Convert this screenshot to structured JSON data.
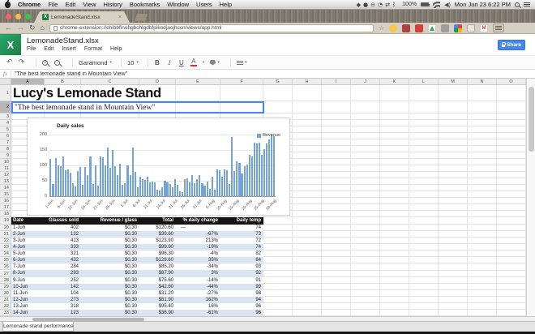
{
  "menubar": {
    "app_menus": [
      "Chrome",
      "File",
      "Edit",
      "View",
      "History",
      "Bookmarks",
      "Window",
      "Users",
      "Help"
    ],
    "status_glyphs": [
      "◆",
      "●",
      "⊖",
      "◔",
      "⇄",
      "ᛒ"
    ],
    "battery_label": "100%",
    "clock": "Mon Jun 23 6:22 PM"
  },
  "browser": {
    "tab_title": "LemonadeStand.xlsx",
    "tab_close": "×",
    "back": "←",
    "forward": "→",
    "reload": "↻",
    "home": "⌂",
    "star": "☆",
    "url": "chrome-extension://ehibbfinohgbchlgdbfpikodjaojhccn/views/app.html"
  },
  "app": {
    "logo_letter": "X",
    "title": "LemonadeStand.xlsx",
    "menus": [
      "File",
      "Edit",
      "Insert",
      "Format",
      "Help"
    ],
    "share_label": "Share",
    "toolbar": {
      "undo": "↶",
      "redo": "↷",
      "zoom_in": "+",
      "zoom_out": "−",
      "font": "Garamond",
      "size": "10",
      "bold": "B",
      "italic": "I",
      "underline": "U",
      "text_color": "A",
      "caret": "▾"
    },
    "formula_prefix": "fx",
    "formula_value": "\"The best lemonade stand in Mountain View\""
  },
  "sheet": {
    "columns": [
      "A",
      "B",
      "C",
      "D",
      "E",
      "F",
      "G",
      "H",
      "I",
      "J",
      "K",
      "L",
      "M",
      "N",
      "O"
    ],
    "row_count": 33,
    "selected_column": "A",
    "selected_row": 2,
    "title": "Lucy's Lemonade Stand",
    "subtitle": "\"The best lemonade stand in Mountain View\"",
    "tab_name": "Lemonade stand performance"
  },
  "chart_data": {
    "type": "bar",
    "title": "Daily sales",
    "legend": [
      "Revenue"
    ],
    "series_color": "#74a3d4",
    "ylim": [
      0,
      200
    ],
    "yticks": [
      0,
      50,
      100,
      150,
      200
    ],
    "x_tick_labels": [
      "1-Jun",
      "6-Jun",
      "11-Jun",
      "16-Jun",
      "21-Jun",
      "26-Jun",
      "1-Jul",
      "6-Jul",
      "11-Jul",
      "16-Jul",
      "21-Jul",
      "26-Jul",
      "31-Jul",
      "5-Aug",
      "10-Aug",
      "15-Aug",
      "20-Aug",
      "25-Aug",
      "30-Aug"
    ],
    "x_tick_positions": [
      0,
      5,
      10,
      15,
      20,
      25,
      30,
      35,
      40,
      45,
      50,
      55,
      60,
      65,
      70,
      75,
      80,
      85,
      90
    ],
    "values": [
      120.6,
      39.6,
      123.9,
      99.9,
      96.3,
      129.6,
      85.2,
      87.9,
      75.6,
      42.6,
      31.2,
      81.9,
      95.4,
      36.9,
      95,
      68,
      128,
      40,
      100,
      33,
      130,
      127,
      100,
      158,
      92,
      150,
      97,
      68,
      105,
      38,
      42,
      100,
      68,
      158,
      80,
      30,
      62,
      55,
      52,
      62,
      45,
      48,
      45,
      22,
      18,
      30,
      50,
      45,
      40,
      28,
      55,
      38,
      15,
      12,
      55,
      57,
      45,
      68,
      42,
      55,
      68,
      42,
      35,
      48,
      25,
      62,
      20,
      88,
      85,
      62,
      88,
      85,
      40,
      193,
      82,
      113,
      108,
      75,
      98,
      102,
      135,
      130,
      173,
      172,
      175,
      135,
      152,
      172,
      185,
      200,
      195
    ]
  },
  "table": {
    "start_row": 20,
    "headers": [
      "Date",
      "Glasses sold",
      "Revenue / glass",
      "Total",
      "% daily change",
      "Daily temp"
    ],
    "rows": [
      [
        "1-Jun",
        "402",
        "$0.30",
        "$120.60",
        "—",
        "74"
      ],
      [
        "2-Jun",
        "132",
        "$0.30",
        "$39.60",
        "-67%",
        "73"
      ],
      [
        "3-Jun",
        "413",
        "$0.30",
        "$123.90",
        "213%",
        "72"
      ],
      [
        "4-Jun",
        "333",
        "$0.30",
        "$99.90",
        "-19%",
        "74"
      ],
      [
        "5-Jun",
        "321",
        "$0.30",
        "$96.30",
        "-4%",
        "82"
      ],
      [
        "6-Jun",
        "432",
        "$0.30",
        "$129.60",
        "35%",
        "84"
      ],
      [
        "7-Jun",
        "284",
        "$0.30",
        "$85.20",
        "-34%",
        "93"
      ],
      [
        "8-Jun",
        "293",
        "$0.30",
        "$87.90",
        "3%",
        "92"
      ],
      [
        "9-Jun",
        "252",
        "$0.30",
        "$75.60",
        "-14%",
        "91"
      ],
      [
        "10-Jun",
        "142",
        "$0.30",
        "$42.60",
        "-44%",
        "99"
      ],
      [
        "11-Jun",
        "104",
        "$0.30",
        "$31.20",
        "-27%",
        "98"
      ],
      [
        "12-Jun",
        "273",
        "$0.30",
        "$81.90",
        "162%",
        "94"
      ],
      [
        "13-Jun",
        "318",
        "$0.30",
        "$95.40",
        "16%",
        "96"
      ],
      [
        "14-Jun",
        "123",
        "$0.30",
        "$36.90",
        "-61%",
        "96"
      ]
    ]
  },
  "colors": {
    "accent_blue": "#4285f4",
    "share_blue": "#4787ed",
    "excel_green": "#1e7c45",
    "band_blue": "#dbe5f1",
    "table_header_black": "#141414",
    "bar_blue": "#74a3d4"
  }
}
